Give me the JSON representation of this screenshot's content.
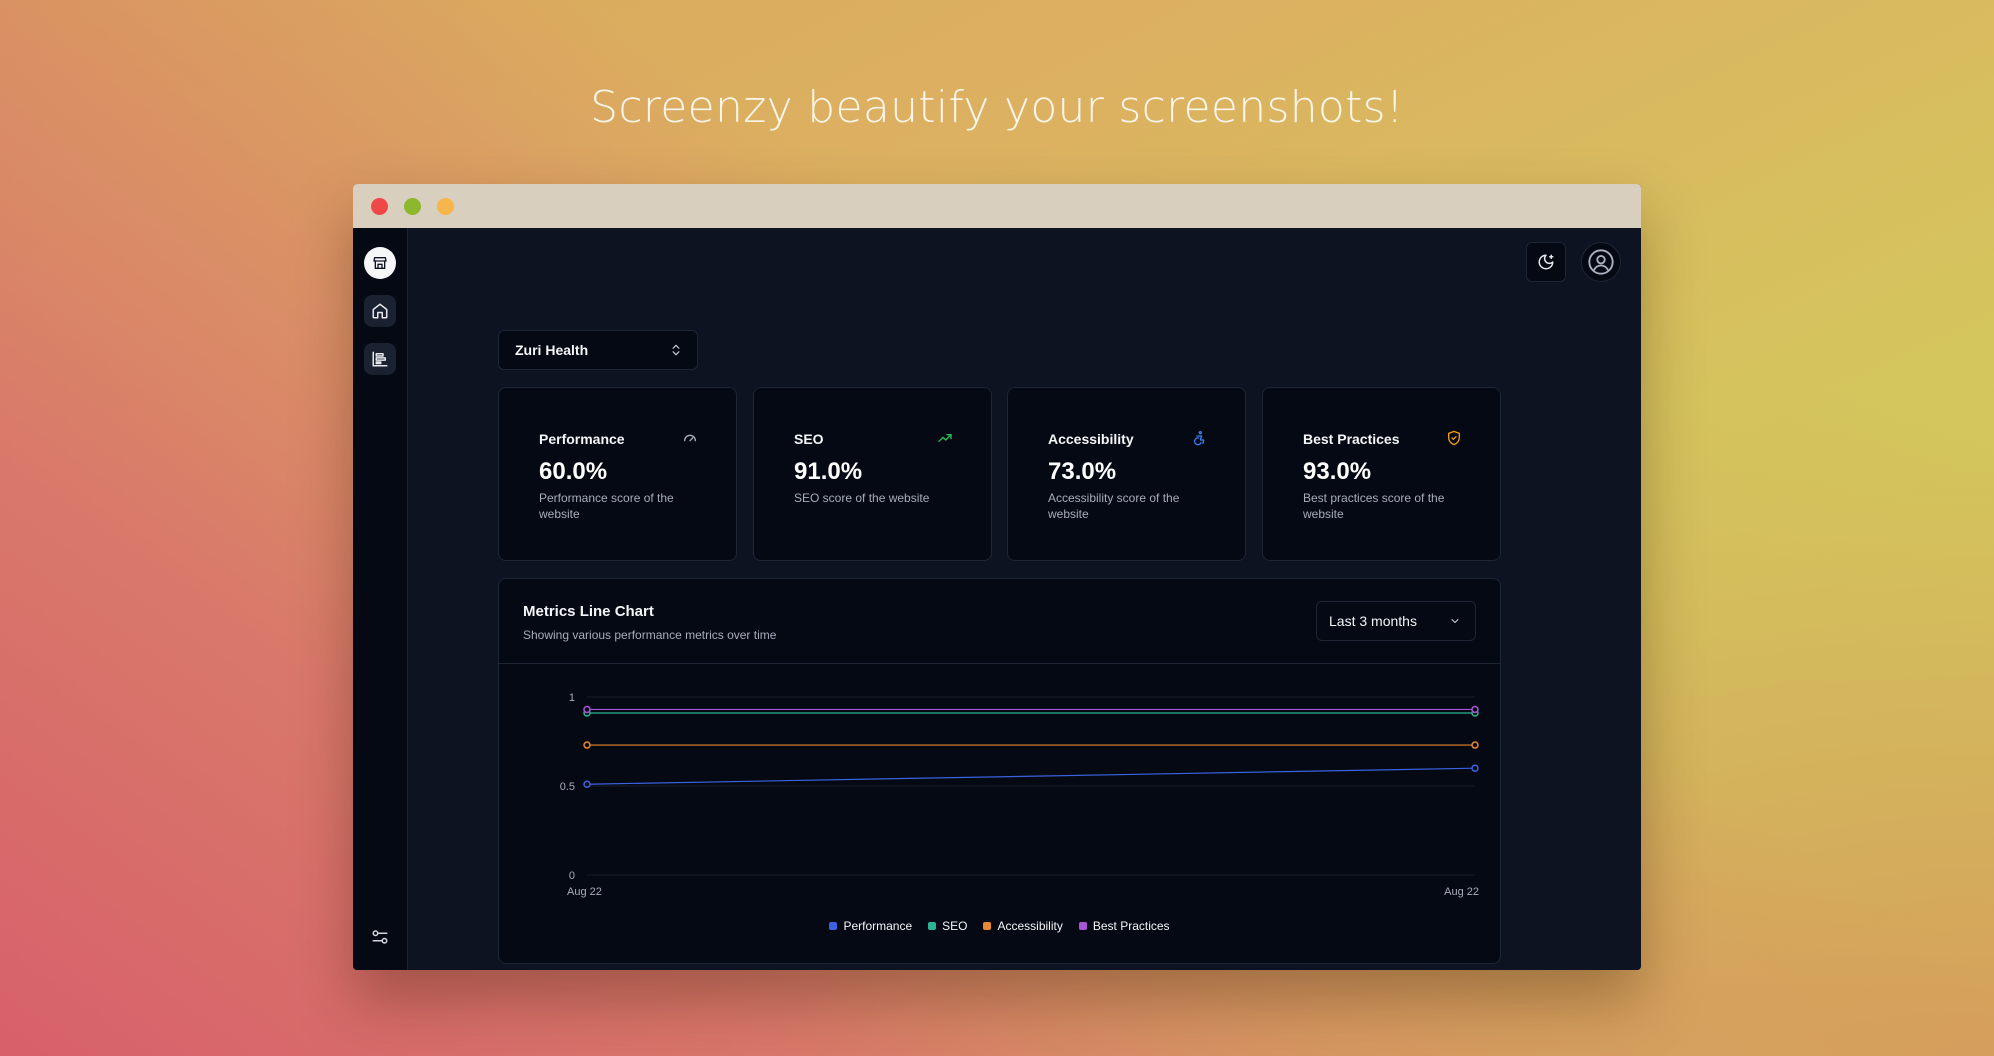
{
  "headline": "Screenzy beautify your screenshots!",
  "window": {
    "controls": [
      "close",
      "minimize",
      "maximize"
    ]
  },
  "sidebar": {
    "items": [
      {
        "icon": "store-icon",
        "label": ""
      },
      {
        "icon": "home-icon",
        "label": ""
      },
      {
        "icon": "reports-icon",
        "label": ""
      }
    ],
    "footer_icon": "settings-sliders-icon"
  },
  "topbar": {
    "theme_icon": "moon-stars-icon",
    "avatar_icon": "user-icon"
  },
  "project_select": {
    "value": "Zuri Health"
  },
  "cards": [
    {
      "title": "Performance",
      "value": "60.0%",
      "description": "Performance score of the website",
      "icon": "gauge-icon",
      "icon_color": "#aab1bf"
    },
    {
      "title": "SEO",
      "value": "91.0%",
      "description": "SEO score of the website",
      "icon": "trending-up-icon",
      "icon_color": "#22c55e"
    },
    {
      "title": "Accessibility",
      "value": "73.0%",
      "description": "Accessibility score of the website",
      "icon": "accessibility-icon",
      "icon_color": "#3b82f6"
    },
    {
      "title": "Best Practices",
      "value": "93.0%",
      "description": "Best practices score of the website",
      "icon": "shield-check-icon",
      "icon_color": "#f59e0b"
    }
  ],
  "chart_section": {
    "title": "Metrics Line Chart",
    "subtitle": "Showing various performance metrics over time",
    "range_select": "Last 3 months"
  },
  "chart_data": {
    "type": "line",
    "x": [
      "Aug 22",
      "Aug 22"
    ],
    "ylim": [
      0,
      1
    ],
    "yticks": [
      "0",
      "0.5",
      "1"
    ],
    "grid": true,
    "legend_position": "bottom",
    "series": [
      {
        "name": "Performance",
        "color": "#3b63e0",
        "values": [
          0.51,
          0.6
        ]
      },
      {
        "name": "SEO",
        "color": "#2bb394",
        "values": [
          0.91,
          0.91
        ]
      },
      {
        "name": "Accessibility",
        "color": "#e8892f",
        "values": [
          0.73,
          0.73
        ]
      },
      {
        "name": "Best Practices",
        "color": "#a855d6",
        "values": [
          0.93,
          0.93
        ]
      }
    ]
  }
}
